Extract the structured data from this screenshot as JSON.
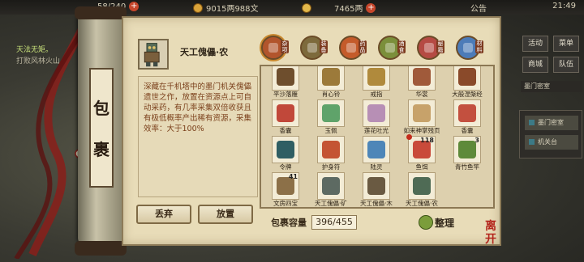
{
  "topbar": {
    "stamina": "58/240",
    "money": "9015两988文",
    "gold": "7465两",
    "notice": "公告",
    "time": "21:49"
  },
  "quest": {
    "title": "天法无矩。",
    "subtitle": "打败风林火山"
  },
  "scroll_title": [
    "包",
    "裹"
  ],
  "detail": {
    "item_name": "天工傀儡·农",
    "description": "深藏在千机塔中的墨门机关傀儡遗世之作，放置在资源点上可自动采药，有几率采集双倍收获且有极低概率产出稀有资源，采集效率：大于100%",
    "discard_label": "丢弃",
    "place_label": "放置"
  },
  "tabs": [
    {
      "label": "杂项",
      "icon": "bag-icon",
      "color": "#b2552c",
      "active": true
    },
    {
      "label": "装备",
      "icon": "weapon-icon",
      "color": "#7d6a3c"
    },
    {
      "label": "药品",
      "icon": "medicine-icon",
      "color": "#c45b2a"
    },
    {
      "label": "酒食",
      "icon": "food-icon",
      "color": "#7b8f3a"
    },
    {
      "label": "秘籍",
      "icon": "book-icon",
      "color": "#b54a43"
    },
    {
      "label": "材料",
      "icon": "crystal-icon",
      "color": "#4c7bb8"
    }
  ],
  "items": [
    {
      "name": "平沙落雁",
      "icon": "scroll-icon",
      "color": "#6e4e2d",
      "count": ""
    },
    {
      "name": "肖心铃",
      "icon": "bell-icon",
      "color": "#9c7a3a",
      "count": ""
    },
    {
      "name": "戒指",
      "icon": "ring-icon",
      "color": "#b08a3c",
      "count": ""
    },
    {
      "name": "华裳",
      "icon": "cloth-icon",
      "color": "#a05a3a",
      "count": ""
    },
    {
      "name": "大般涅槃经",
      "icon": "book-icon",
      "color": "#8a4a2a",
      "count": ""
    },
    {
      "name": "香囊",
      "icon": "pouch-icon",
      "color": "#c1483a",
      "count": ""
    },
    {
      "name": "玉佩",
      "icon": "jade-icon",
      "color": "#5fa36a",
      "count": ""
    },
    {
      "name": "莲花吐光",
      "icon": "lotus-icon",
      "color": "#b78fb5",
      "count": ""
    },
    {
      "name": "如来神掌残页",
      "icon": "page-icon",
      "color": "#c7a26a",
      "count": ""
    },
    {
      "name": "香囊",
      "icon": "pouch-icon",
      "color": "#c3503f",
      "count": ""
    },
    {
      "name": "令牌",
      "icon": "token-icon",
      "color": "#2f5e63",
      "count": ""
    },
    {
      "name": "护身符",
      "icon": "charm-icon",
      "color": "#c45433",
      "count": ""
    },
    {
      "name": "陆灵",
      "icon": "blade-icon",
      "color": "#4e86b8",
      "count": ""
    },
    {
      "name": "鱼饵",
      "icon": "worm-icon",
      "color": "#c94a3a",
      "count": "118"
    },
    {
      "name": "青竹鱼竿",
      "icon": "rod-icon",
      "color": "#5e8a3a",
      "count": "3"
    },
    {
      "name": "文房四宝",
      "icon": "stationery-icon",
      "color": "#8c7048",
      "count": "41"
    },
    {
      "name": "天工傀儡·矿",
      "icon": "puppet-icon",
      "color": "#5d6a62",
      "count": ""
    },
    {
      "name": "天工傀儡·木",
      "icon": "puppet-icon",
      "color": "#6a5a42",
      "count": ""
    },
    {
      "name": "天工傀儡·农",
      "icon": "puppet-icon",
      "color": "#4f6b55",
      "count": ""
    }
  ],
  "capacity": {
    "label": "包裹容量",
    "value": "396/455"
  },
  "sort_label": "整理",
  "side_menu": {
    "buttons": [
      "活动",
      "菜单",
      "商城",
      "队伍"
    ],
    "location": "墨门密室",
    "rows": [
      "墨门密室",
      "机关台"
    ]
  },
  "seal_text": "离开"
}
